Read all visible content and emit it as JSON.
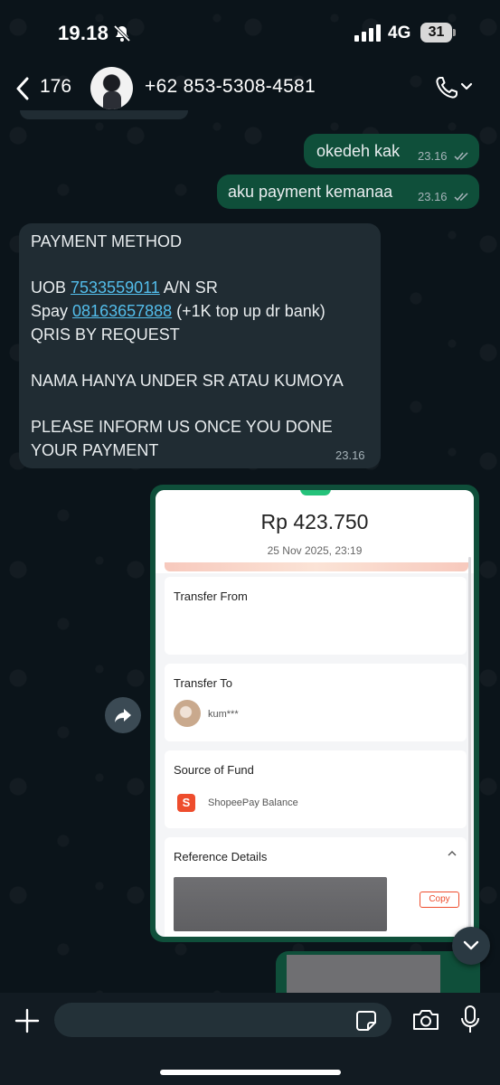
{
  "status_bar": {
    "time": "19.18",
    "network": "4G",
    "battery": "31"
  },
  "header": {
    "back_count": "176",
    "contact_name": "+62 853-5308-4581"
  },
  "messages": {
    "out_1": {
      "text": "okedeh kak",
      "time": "23.16"
    },
    "out_2": {
      "text": "aku payment kemanaa",
      "time": "23.16"
    },
    "payment": {
      "title": "PAYMENT METHOD",
      "uob_prefix": "UOB ",
      "uob_number": "7533559011",
      "uob_suffix": " A/N SR",
      "spay_prefix": "Spay ",
      "spay_number": "08163657888",
      "spay_suffix": " (+1K top up dr bank)",
      "qris": "QRIS BY REQUEST",
      "name_note": "NAMA HANYA UNDER SR ATAU KUMOYA",
      "inform_line1": "PLEASE INFORM US ONCE YOU DONE",
      "inform_line2": "YOUR PAYMENT",
      "time": "23.16"
    },
    "receipt": {
      "amount": "Rp 423.750",
      "date": "25 Nov 2025, 23:19",
      "transfer_from_label": "Transfer From",
      "transfer_to_label": "Transfer To",
      "recipient": "kum***",
      "source_label": "Source of Fund",
      "source_value": "ShopeePay Balance",
      "reference_label": "Reference Details",
      "copy_label": "Copy",
      "time": "23.19"
    }
  },
  "icons": {
    "back": "chevron-left-icon",
    "call": "phone-icon",
    "bell_off": "bell-off-icon",
    "forward": "forward-icon",
    "scroll_down": "chevron-down-icon",
    "plus": "plus-icon",
    "sticker": "sticker-icon",
    "camera": "camera-icon",
    "mic": "mic-icon"
  },
  "colors": {
    "background": "#0b141a",
    "outgoing_bubble": "#0f4f3a",
    "incoming_bubble": "#202c33",
    "link": "#53bdeb",
    "shopee_orange": "#ee4d2d"
  }
}
